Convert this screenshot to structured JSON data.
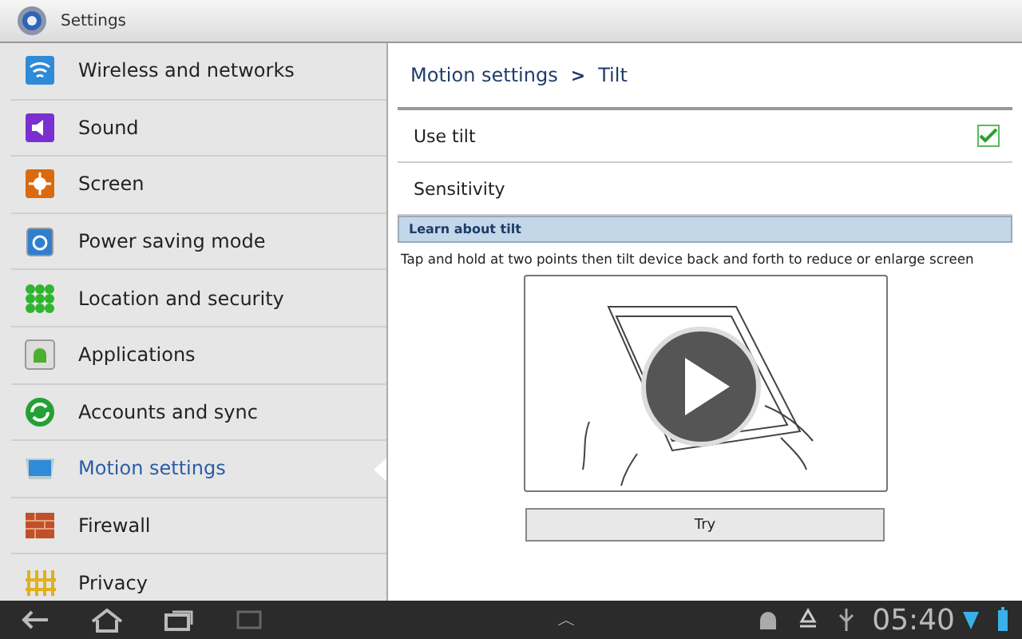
{
  "title_bar": {
    "title": "Settings"
  },
  "sidebar": {
    "items": [
      {
        "label": "Wireless and networks",
        "selected": false
      },
      {
        "label": "Sound",
        "selected": false
      },
      {
        "label": "Screen",
        "selected": false
      },
      {
        "label": "Power saving mode",
        "selected": false
      },
      {
        "label": "Location and security",
        "selected": false
      },
      {
        "label": "Applications",
        "selected": false
      },
      {
        "label": "Accounts and sync",
        "selected": false
      },
      {
        "label": "Motion settings",
        "selected": true
      },
      {
        "label": "Firewall",
        "selected": false
      },
      {
        "label": "Privacy",
        "selected": false
      }
    ]
  },
  "detail": {
    "breadcrumb_parent": "Motion settings",
    "breadcrumb_separator": ">",
    "breadcrumb_current": "Tilt",
    "rows": [
      {
        "label": "Use tilt",
        "kind": "checkbox",
        "checked": true
      },
      {
        "label": "Sensitivity",
        "kind": "plain"
      }
    ],
    "section_header": "Learn about tilt",
    "description": "Tap and hold at two points then tilt device back and forth to reduce or enlarge screen",
    "button": "Try"
  },
  "status_bar": {
    "up_caret": "︿",
    "time": "05:40"
  }
}
